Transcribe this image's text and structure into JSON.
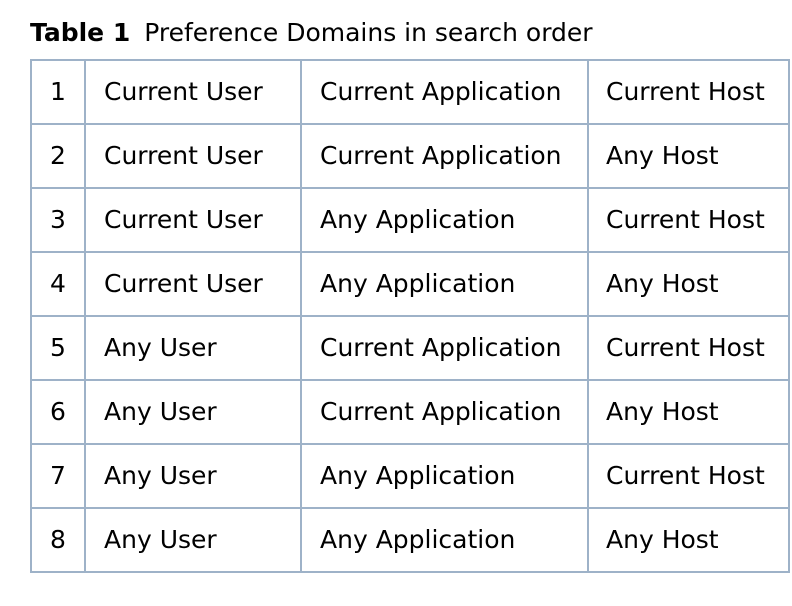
{
  "caption": {
    "label": "Table 1",
    "title": "Preference Domains in search order"
  },
  "rows": [
    {
      "num": "1",
      "user": "Current User",
      "application": "Current Application",
      "host": "Current Host"
    },
    {
      "num": "2",
      "user": "Current User",
      "application": "Current Application",
      "host": "Any Host"
    },
    {
      "num": "3",
      "user": "Current User",
      "application": "Any Application",
      "host": "Current Host"
    },
    {
      "num": "4",
      "user": "Current User",
      "application": "Any Application",
      "host": "Any Host"
    },
    {
      "num": "5",
      "user": "Any User",
      "application": "Current Application",
      "host": "Current Host"
    },
    {
      "num": "6",
      "user": "Any User",
      "application": "Current Application",
      "host": "Any Host"
    },
    {
      "num": "7",
      "user": "Any User",
      "application": "Any Application",
      "host": "Current Host"
    },
    {
      "num": "8",
      "user": "Any User",
      "application": "Any Application",
      "host": "Any Host"
    }
  ],
  "colors": {
    "border": "#9eb2c8",
    "text": "#000000",
    "background": "#ffffff"
  }
}
